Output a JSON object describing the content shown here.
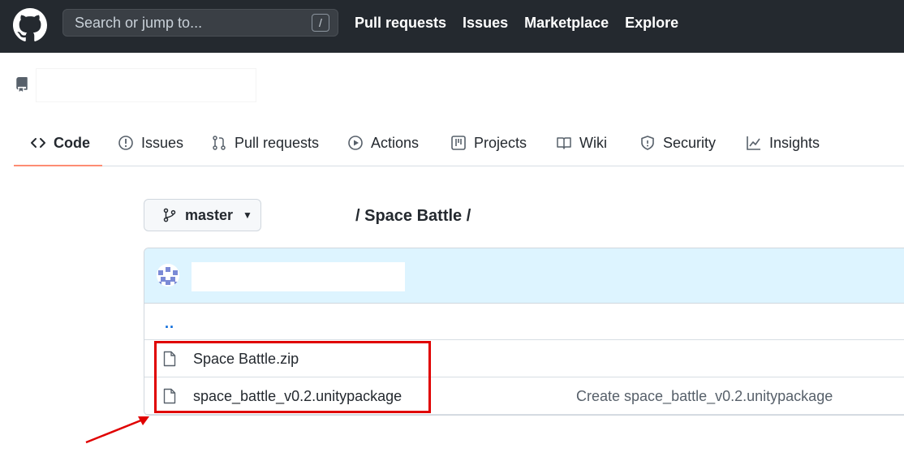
{
  "header": {
    "search_placeholder": "Search or jump to...",
    "search_key_hint": "/",
    "nav": [
      {
        "label": "Pull requests"
      },
      {
        "label": "Issues"
      },
      {
        "label": "Marketplace"
      },
      {
        "label": "Explore"
      }
    ]
  },
  "repo": {
    "tabs": [
      {
        "label": "Code",
        "icon": "code-icon"
      },
      {
        "label": "Issues",
        "icon": "issue-icon"
      },
      {
        "label": "Pull requests",
        "icon": "pull-request-icon"
      },
      {
        "label": "Actions",
        "icon": "play-icon"
      },
      {
        "label": "Projects",
        "icon": "project-icon"
      },
      {
        "label": "Wiki",
        "icon": "book-icon"
      },
      {
        "label": "Security",
        "icon": "shield-icon"
      },
      {
        "label": "Insights",
        "icon": "graph-icon"
      }
    ],
    "branch": "master",
    "path": "/ Space Battle /"
  },
  "files": {
    "parent_link": "..",
    "items": [
      {
        "name": "Space Battle.zip",
        "commit_message": ""
      },
      {
        "name": "space_battle_v0.2.unitypackage",
        "commit_message": "Create space_battle_v0.2.unitypackage"
      }
    ]
  },
  "colors": {
    "header_bg": "#24292f",
    "accent_underline": "#fd8c73",
    "link": "#0969da",
    "annotation": "#e00000"
  }
}
